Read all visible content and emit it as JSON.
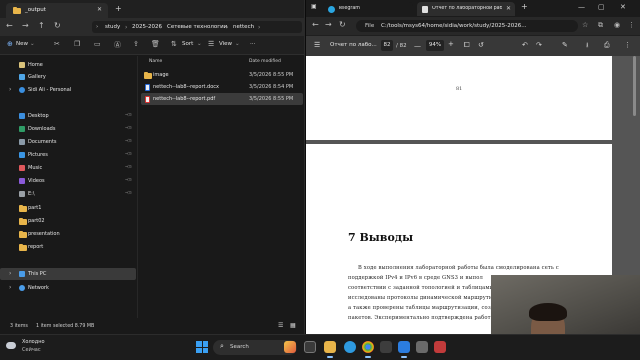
{
  "explorer": {
    "tab_title": "_output",
    "breadcrumb": [
      "study",
      "2025-2026",
      "Сетевые технологии",
      "nettech"
    ],
    "commands": {
      "new": "New",
      "sort": "Sort",
      "view": "View"
    },
    "sidebar": [
      {
        "label": "Home"
      },
      {
        "label": "Gallery"
      },
      {
        "label": "Sidi Ali - Personal"
      },
      {
        "label": "Desktop"
      },
      {
        "label": "Downloads"
      },
      {
        "label": "Documents"
      },
      {
        "label": "Pictures"
      },
      {
        "label": "Music"
      },
      {
        "label": "Videos"
      },
      {
        "label": "E:\\"
      },
      {
        "label": "part1"
      },
      {
        "label": "part02"
      },
      {
        "label": "presentation"
      },
      {
        "label": "report"
      },
      {
        "label": "This PC"
      },
      {
        "label": "Network"
      }
    ],
    "columns": {
      "name": "Name",
      "date": "Date modified"
    },
    "files": [
      {
        "name": "image",
        "date": "3/5/2026 8:55 PM"
      },
      {
        "name": "nettech--lab8--report.docx",
        "date": "3/5/2026 8:54 PM"
      },
      {
        "name": "nettech--lab8--report.pdf",
        "date": "3/5/2026 8:55 PM"
      }
    ],
    "status": {
      "items": "3 items",
      "selected": "1 item selected  8.79 MB"
    }
  },
  "browser": {
    "tabs": [
      {
        "title": "Telegram"
      },
      {
        "title": "Отчет по лабораторной рабо"
      }
    ],
    "url_chip": "File",
    "url": "C:/tools/msys64/home/sidia/work/study/2025-2026...",
    "pdf": {
      "title": "Отчет по лабо...",
      "page": "82",
      "page_total": "/ 82",
      "zoom": "94%",
      "page_number": "81",
      "section_title": "7  Выводы",
      "lines": [
        "В ходе выполнения лабораторной работы была смоделирована сеть с",
        "поддержкой IPv4 и IPv6 в среде GNS3 и выпол",
        "соответствии с заданной топологией и таблицами",
        "исследованы протоколы динамической маршрутизац",
        "а также проверены таблицы маршрутизации, созд",
        "пакетов. Экспериментально подтверждена работа"
      ]
    }
  },
  "taskbar": {
    "weather_temp": "Холодно",
    "weather_sub": "Сейчас",
    "search": "Search"
  }
}
